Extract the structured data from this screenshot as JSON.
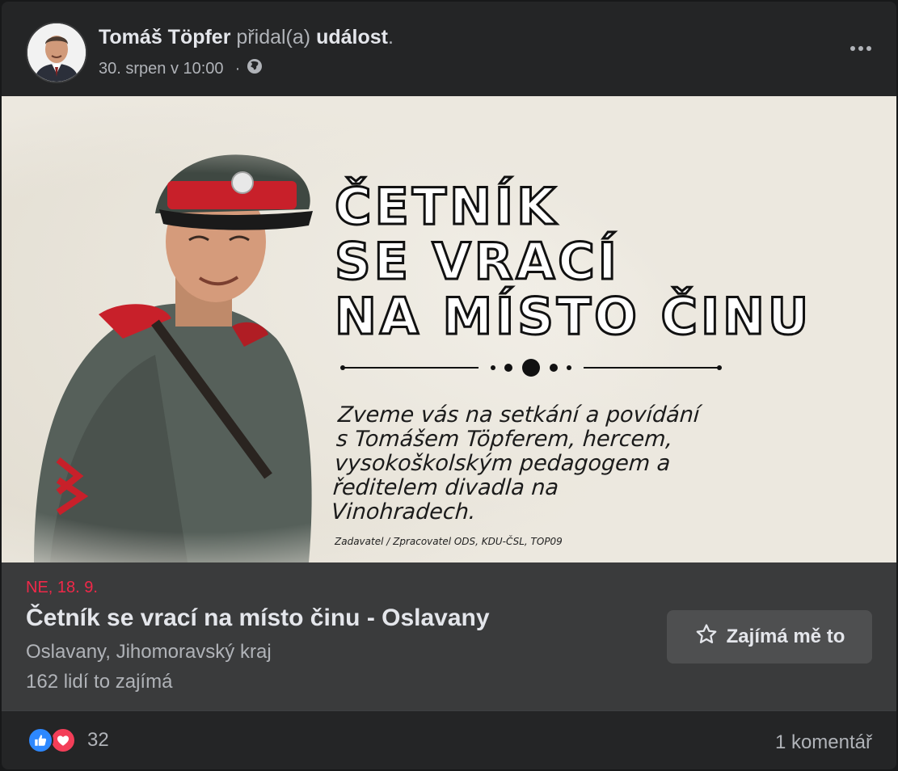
{
  "post": {
    "author_name": "Tomáš Töpfer",
    "action_text": "přidal(a)",
    "object_text": "událost",
    "period": ".",
    "timestamp": "30. srpen v 10:00",
    "separator": "·",
    "audience_icon": "globe-icon",
    "more_icon": "more-options-icon"
  },
  "event_image": {
    "headline": [
      "ČETNÍK",
      "SE VRACÍ",
      "NA MÍSTO ČINU"
    ],
    "invite_lines": [
      "Zveme vás na setkání a povídání",
      "s Tomášem Töpferem, hercem,",
      "vysokoškolským pedagogem a",
      "ředitelem divadla na Vinohradech."
    ],
    "sponsor": "Zadavatel / Zpracovatel ODS, KDU-ČSL, TOP09"
  },
  "event": {
    "date": "NE, 18. 9.",
    "title": "Četník se vrací na místo činu - Oslavany",
    "location": "Oslavany, Jihomoravský kraj",
    "interest_count": "162 lidí to zajímá",
    "interest_button_label": "Zajímá mě to"
  },
  "footer": {
    "reaction_count": "32",
    "comment_count": "1 komentář"
  },
  "colors": {
    "background": "#18191a",
    "card": "#242526",
    "event_panel": "#3a3b3c",
    "date_red": "#f02849",
    "like_blue": "#2d88ff",
    "love_red": "#f33e58"
  }
}
